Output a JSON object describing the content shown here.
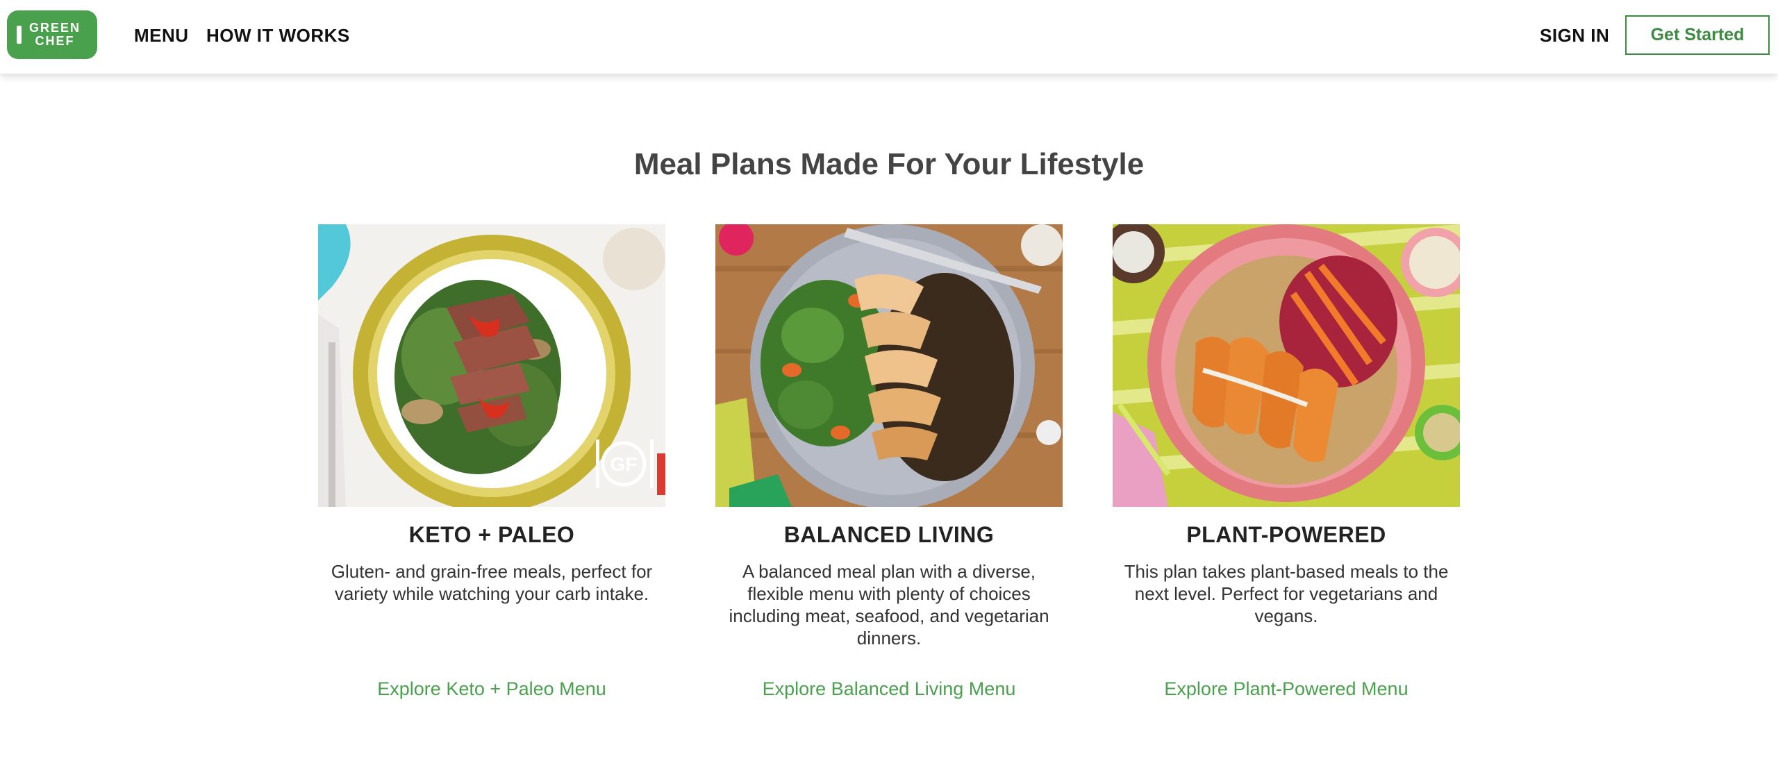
{
  "header": {
    "logo_text": "GREEN\nCHEF",
    "nav": {
      "menu": "MENU",
      "how_it_works": "HOW IT WORKS",
      "sign_in": "SIGN IN"
    },
    "cta": "Get Started"
  },
  "main": {
    "heading": "Meal Plans Made For Your Lifestyle",
    "cards": [
      {
        "title": "KETO + PALEO",
        "description": "Gluten- and grain-free meals, perfect for variety while watching your carb intake.",
        "link": "Explore Keto + Paleo Menu",
        "badge": "GF"
      },
      {
        "title": "BALANCED LIVING",
        "description": "A balanced meal plan with a diverse, flexible menu with plenty of choices including meat, seafood, and vegetarian dinners.",
        "link": "Explore Balanced Living Menu"
      },
      {
        "title": "PLANT-POWERED",
        "description": "This plan takes plant-based meals to the next level. Perfect for vegetarians and vegans.",
        "link": "Explore Plant-Powered Menu"
      }
    ]
  },
  "colors": {
    "brand_green": "#4aa14d",
    "cta_green": "#3d8b40",
    "heading": "#444444"
  }
}
